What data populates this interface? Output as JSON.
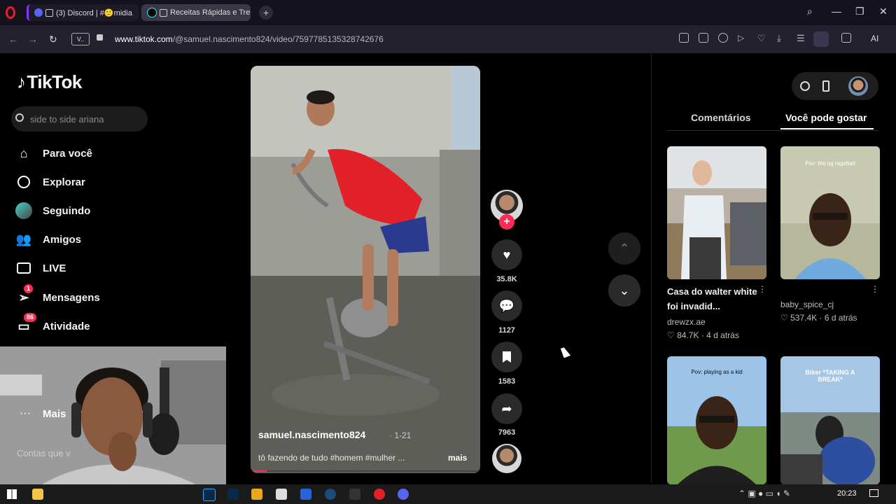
{
  "browser": {
    "tabs": [
      {
        "label": "(3) Discord | #🙂midia"
      },
      {
        "label": "Receitas Rápidas e Trei"
      }
    ],
    "url_prefix": "www.tiktok.com",
    "url_path": "/@samuel.nascimento824/video/7597785135328742676",
    "ai_label": "AI"
  },
  "sidebar": {
    "logo": "TikTok",
    "search_placeholder": "side to side ariana",
    "items": [
      {
        "label": "Para você",
        "icon": "home-icon"
      },
      {
        "label": "Explorar",
        "icon": "compass-icon"
      },
      {
        "label": "Seguindo",
        "icon": "following-avatar-icon"
      },
      {
        "label": "Amigos",
        "icon": "friends-icon"
      },
      {
        "label": "LIVE",
        "icon": "live-icon"
      },
      {
        "label": "Mensagens",
        "icon": "messages-icon",
        "badge": "1"
      },
      {
        "label": "Atividade",
        "icon": "activity-icon",
        "badge": "86"
      }
    ],
    "more_label": "Mais",
    "accounts_label": "Contas que v"
  },
  "video": {
    "username": "samuel.nascimento824",
    "date": "· 1-21",
    "caption": "tô fazendo de tudo #homem #mulher ...",
    "more": "mais"
  },
  "actions": {
    "likes": "35.8K",
    "comments": "1127",
    "saves": "1583",
    "shares": "7963"
  },
  "panel": {
    "tab_comments": "Comentários",
    "tab_suggested": "Você pode gostar",
    "cards": [
      {
        "title": "Casa do walter white foi invadid...",
        "author": "drewzx.ae",
        "likes": "84.7K",
        "age": "4 d atrás",
        "overlay": ""
      },
      {
        "title": "",
        "author": "baby_spice_cj",
        "likes": "537.4K",
        "age": "6 d atrás",
        "overlay": "Pov: the og ragebait"
      },
      {
        "title": "",
        "author": "",
        "likes": "",
        "age": "",
        "overlay": "Pov: playing as a kid"
      },
      {
        "title": "",
        "author": "",
        "likes": "",
        "age": "",
        "overlay": "Biker *TAKING A BREAK*"
      }
    ]
  },
  "taskbar": {
    "time": "20:23"
  },
  "colors": {
    "accent": "#fe2c55",
    "browser_accent": "#7b3cff"
  }
}
